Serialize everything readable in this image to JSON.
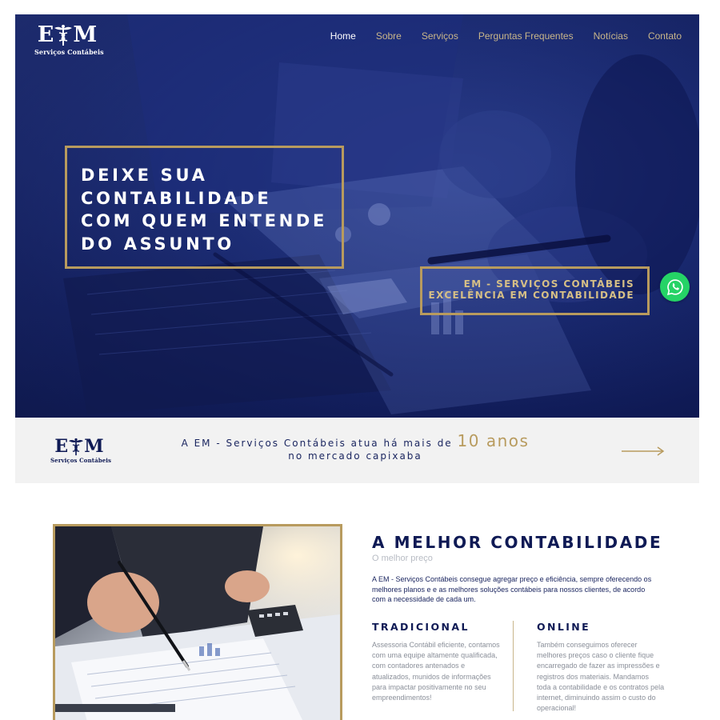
{
  "brand": {
    "logo_left": "E",
    "logo_right": "M",
    "logo_subtitle": "Serviços Contábeis"
  },
  "nav": {
    "items": [
      {
        "label": "Home",
        "active": true
      },
      {
        "label": "Sobre",
        "active": false
      },
      {
        "label": "Serviços",
        "active": false
      },
      {
        "label": "Perguntas Frequentes",
        "active": false
      },
      {
        "label": "Notícias",
        "active": false
      },
      {
        "label": "Contato",
        "active": false
      }
    ]
  },
  "hero": {
    "title_lines": [
      "DEIXE SUA",
      "CONTABILIDADE",
      "COM QUEM ENTENDE",
      "DO ASSUNTO"
    ],
    "subtitle_lines": [
      "EM - SERVIÇOS CONTÁBEIS",
      "EXCELÊNCIA EM CONTABILIDADE"
    ]
  },
  "whatsapp": {
    "icon": "whatsapp-icon",
    "color": "#25d366"
  },
  "strip": {
    "text_before": "A EM - Serviços Contábeis atua há mais de ",
    "years": "10 anos",
    "text_after": " no mercado capixaba",
    "arrow_icon": "arrow-right-icon"
  },
  "about": {
    "title": "A MELHOR CONTABILIDADE",
    "subtitle": "O melhor preço",
    "description": "A EM - Serviços Contábeis consegue agregar preço e eficiência, sempre oferecendo os melhores planos e e as melhores soluções contábeis para nossos clientes, de acordo com a necessidade de cada um.",
    "columns": [
      {
        "title": "TRADICIONAL",
        "text": "Assessoria Contábil eficiente, contamos com uma equipe altamente qualificada, com contadores antenados e atualizados, munidos de informações para impactar positivamente no seu empreendimentos!"
      },
      {
        "title": "ONLINE",
        "text": "Também conseguimos oferecer melhores preços caso o cliente fique encarregado de fazer as impressões e registros dos materiais. Mandamos toda a contabilidade e os contratos pela internet, diminuindo assim o custo do operacional!"
      }
    ]
  },
  "colors": {
    "navy": "#0f1a55",
    "gold": "#b89b5e",
    "light_gray": "#f2f2f2"
  }
}
